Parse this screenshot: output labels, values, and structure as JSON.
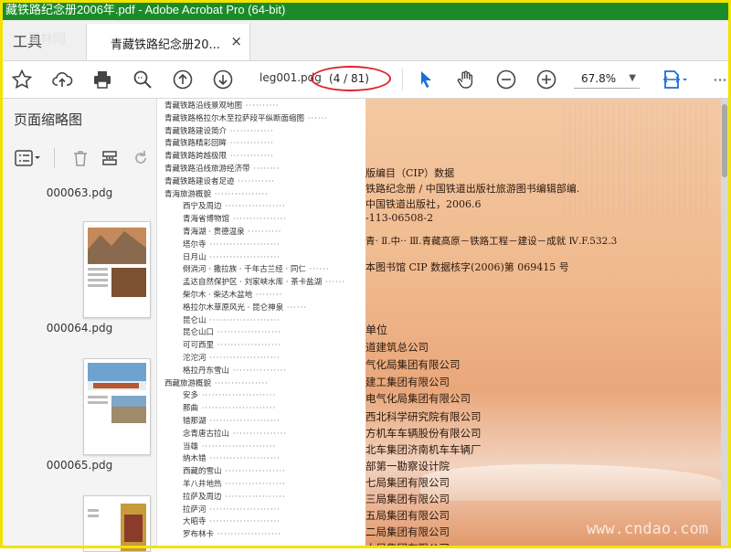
{
  "window": {
    "title": "藏铁路纪念册2006年.pdf - Adobe Acrobat Pro (64-bit)"
  },
  "tabs": {
    "tools_label": "工具",
    "doc_label": "青藏铁路纪念册20...",
    "close_glyph": "×",
    "watermark": "百林网"
  },
  "toolbar": {
    "icons": [
      "star-icon",
      "cloud-upload-icon",
      "print-icon",
      "zoom-search-icon",
      "page-up-icon",
      "page-down-icon",
      "select-arrow-icon",
      "hand-icon",
      "zoom-out-icon",
      "zoom-in-icon",
      "fit-page-icon",
      "more-icon"
    ],
    "filename": "leg001.pdg",
    "page_indicator": "(4 / 81)",
    "zoom": "67.8%",
    "more": "···"
  },
  "sidebar": {
    "title": "页面缩略图",
    "thumbnails": [
      {
        "label": "000063.pdg"
      },
      {
        "label": "000064.pdg"
      },
      {
        "label": "000065.pdg"
      },
      {
        "label": ""
      }
    ]
  },
  "toc": {
    "items": [
      {
        "text": "青藏铁路沿线景观地图",
        "indent": 0
      },
      {
        "text": "青藏铁路格拉尔木至拉萨段平纵断面缩图",
        "indent": 0
      },
      {
        "text": "青藏铁路建设简介",
        "indent": 0
      },
      {
        "text": "青藏铁路精彩回眸",
        "indent": 0
      },
      {
        "text": "青藏铁路跨越极限",
        "indent": 0
      },
      {
        "text": "青藏铁路沿线旅游经济带",
        "indent": 0
      },
      {
        "text": "青藏铁路建设者足迹",
        "indent": 0
      },
      {
        "text": "青海旅游概貌",
        "indent": 0
      },
      {
        "text": "西宁及周边",
        "indent": 1
      },
      {
        "text": "青海省博物馆",
        "indent": 2
      },
      {
        "text": "青海湖 · 贵德温泉",
        "indent": 2
      },
      {
        "text": "塔尔寺",
        "indent": 1
      },
      {
        "text": "日月山",
        "indent": 1
      },
      {
        "text": "倒淌河 · 撒拉族 · 千年古兰经 · 同仁",
        "indent": 1
      },
      {
        "text": "孟达自然保护区 · 刘家峡水库 · 茶卡盐湖",
        "indent": 1
      },
      {
        "text": "柴尔木 · 柴达木盆地",
        "indent": 1
      },
      {
        "text": "格拉尔木草原风光 · 昆仑神泉",
        "indent": 1
      },
      {
        "text": "昆仑山",
        "indent": 1
      },
      {
        "text": "昆仑山口",
        "indent": 1
      },
      {
        "text": "可可西里",
        "indent": 1
      },
      {
        "text": "沱沱河",
        "indent": 1
      },
      {
        "text": "格拉丹东雪山",
        "indent": 1
      },
      {
        "text": "西藏旅游概貌",
        "indent": 0
      },
      {
        "text": "安多",
        "indent": 1
      },
      {
        "text": "那曲",
        "indent": 1
      },
      {
        "text": "错那湖",
        "indent": 1
      },
      {
        "text": "念青唐古拉山",
        "indent": 1
      },
      {
        "text": "当雄",
        "indent": 1
      },
      {
        "text": "纳木错",
        "indent": 1
      },
      {
        "text": "西藏的雪山",
        "indent": 1
      },
      {
        "text": "羊八井地热",
        "indent": 1
      },
      {
        "text": "拉萨及周边",
        "indent": 1
      },
      {
        "text": "拉萨河",
        "indent": 1
      },
      {
        "text": "大昭寺",
        "indent": 1
      },
      {
        "text": "罗布林卡",
        "indent": 1
      }
    ]
  },
  "cover": {
    "lines": [
      "版编目（CIP）数据",
      "铁路纪念册 / 中国铁道出版社旅游图书编辑部编.",
      "中国铁道出版社，2006.6",
      "-113-06508-2",
      "青·  Ⅱ.中··  Ⅲ.青藏高原－铁路工程－建设－成就  Ⅳ.F.532.3",
      "本图书馆 CIP 数据核字(2006)第 069415 号",
      "单位",
      "道建筑总公司",
      "气化局集团有限公司",
      "建工集团有限公司",
      "电气化局集团有限公司",
      "西北科学研究院有限公司",
      "方机车车辆股份有限公司",
      "北车集团济南机车车辆厂",
      "部第一勘察设计院",
      "七局集团有限公司",
      "三局集团有限公司",
      "五局集团有限公司",
      "二局集团有限公司",
      "十局集团有限公司"
    ],
    "watermark": "www.cndao.com"
  },
  "colors": {
    "title_green": "#1b8b2a",
    "frame_yellow": "#f2e200",
    "annotation_red": "#e0222a",
    "accent_blue": "#1a6fd6"
  }
}
